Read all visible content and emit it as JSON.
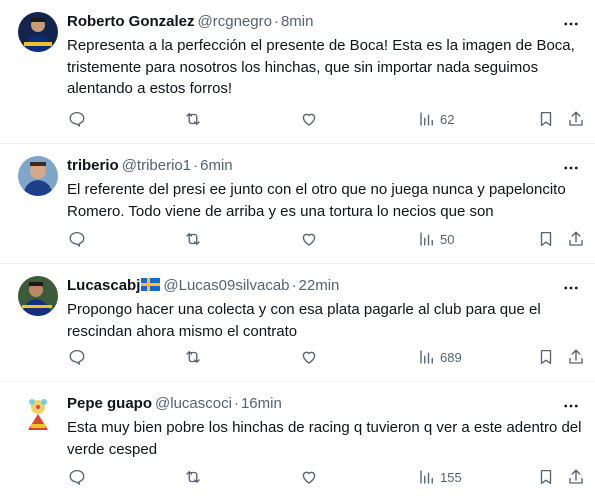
{
  "tweets": [
    {
      "name": "Roberto Gonzalez",
      "handle": "@rcgnegro",
      "separator": "·",
      "time": "8min",
      "text": "Representa a la perfección el presente de Boca! Esta es la imagen de Boca, tristemente para nosotros los hinchas, que sin importar nada seguimos alentando a estos forros!",
      "views": "62"
    },
    {
      "name": "triberio",
      "handle": "@triberio1",
      "separator": "·",
      "time": "6min",
      "text": "El referente del presi ee junto con el otro que no juega nunca y papeloncito Romero. Todo viene de arriba y es una tortura lo necios que son",
      "views": "50"
    },
    {
      "name": "Lucascabj",
      "name_flag": "swedish-flag-emoji",
      "handle": "@Lucas09silvacab",
      "separator": "·",
      "time": "22min",
      "text": "Propongo hacer una colecta y con esa plata pagarle al club para que el rescindan ahora mismo el contrato",
      "views": "689"
    },
    {
      "name": "Pepe guapo",
      "handle": "@lucascoci",
      "separator": "·",
      "time": "16min",
      "text": "Esta muy bien pobre los hinchas de racing q tuvieron q ver a este adentro del verde cesped",
      "views": "155"
    }
  ],
  "icons": {
    "more": "more-horizontal-icon",
    "reply": "reply-icon",
    "retweet": "retweet-icon",
    "like": "heart-icon",
    "views": "views-chart-icon",
    "bookmark": "bookmark-icon",
    "share": "share-icon"
  },
  "colors": {
    "text": "#0f1419",
    "secondary": "#536471",
    "divider": "#eff3f4"
  }
}
